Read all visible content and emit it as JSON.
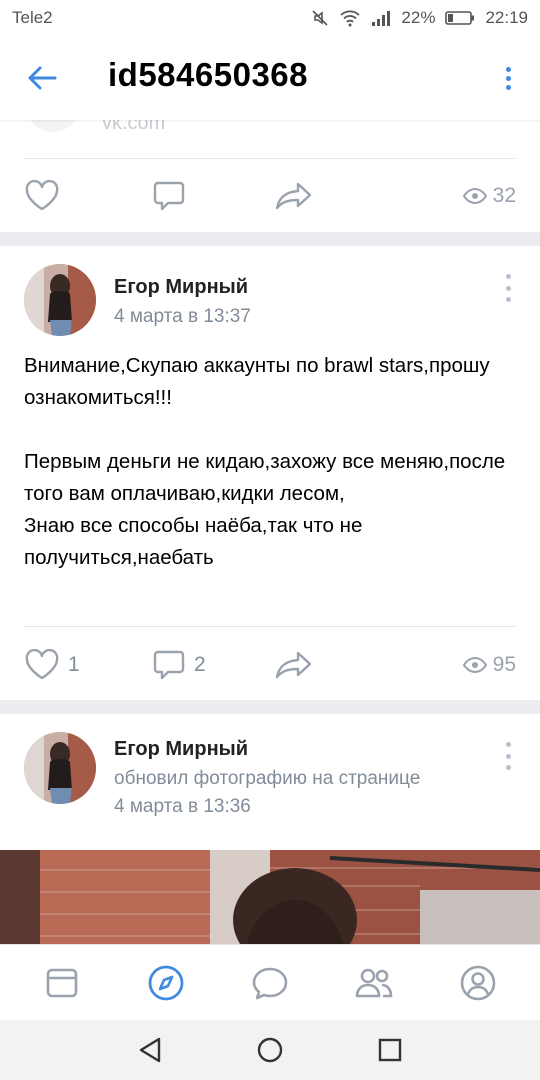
{
  "status_bar": {
    "carrier": "Tele2",
    "battery": "22%",
    "time": "22:19"
  },
  "header": {
    "title": "id584650368"
  },
  "posts": [
    {
      "source_text": "vk.com",
      "likes": "",
      "comments": "",
      "views": "32"
    },
    {
      "author": "Егор Мирный",
      "date": "4 марта в 13:37",
      "text": "Внимание,Скупаю аккаунты по brawl stars,прошу ознакомиться!!!\n\nПервым деньги не кидаю,захожу все меняю,после того вам оплачиваю,кидки лесом,\nЗнаю все способы наёба,так что не получиться,наебать",
      "likes": "1",
      "comments": "2",
      "views": "95"
    },
    {
      "author": "Егор Мирный",
      "action": "обновил фотографию на странице",
      "date": "4 марта в 13:36"
    }
  ],
  "colors": {
    "accent": "#3f8ae0",
    "icon_grey": "#818c99",
    "background": "#ebedf0"
  },
  "tabbar": {
    "tabs": [
      "news-icon",
      "explore-icon",
      "messages-icon",
      "friends-icon",
      "profile-icon"
    ],
    "active": "explore-icon"
  }
}
